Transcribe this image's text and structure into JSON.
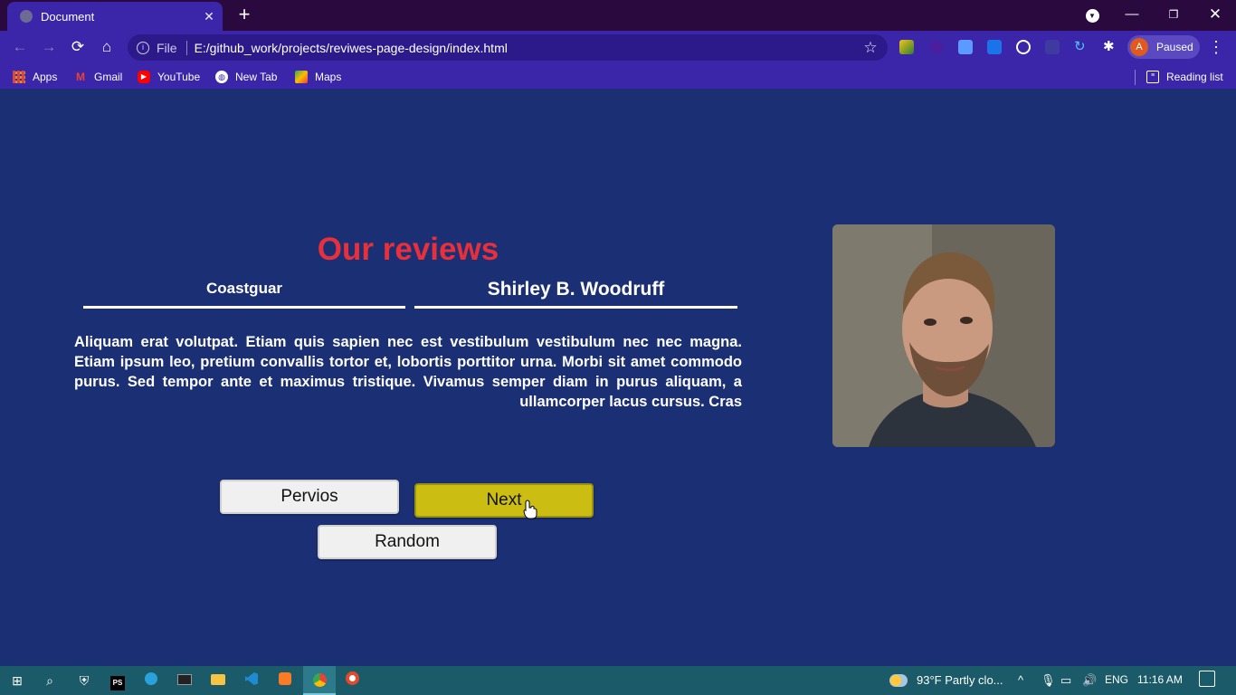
{
  "browser": {
    "tab_title": "Document",
    "tab_close": "✕",
    "new_tab": "+",
    "url_scheme_label": "File",
    "url": "E:/github_work/projects/reviwes-page-design/index.html",
    "profile_initial": "A",
    "profile_status": "Paused",
    "window_controls": {
      "minimize": "—",
      "maximize": "❐",
      "close": "✕"
    }
  },
  "bookmarks": [
    {
      "label": "Apps",
      "icon": "apps-grid-icon"
    },
    {
      "label": "Gmail",
      "icon": "gmail-icon",
      "glyph": "M"
    },
    {
      "label": "YouTube",
      "icon": "youtube-icon",
      "glyph": "▶"
    },
    {
      "label": "New Tab",
      "icon": "globe-icon",
      "glyph": "◍"
    },
    {
      "label": "Maps",
      "icon": "maps-icon"
    }
  ],
  "reading_list": {
    "label": "Reading list",
    "icon": "reading-list-icon"
  },
  "page": {
    "title": "Our reviews",
    "left_heading": "Coastguar",
    "right_heading": "Shirley B. Woodruff",
    "review_text": "Aliquam erat volutpat. Etiam quis sapien nec est vestibulum vestibulum nec nec magna. Etiam ipsum leo, pretium convallis tortor et, lobortis porttitor urna. Morbi sit amet commodo purus. Sed tempor ante et maximus tristique. Vivamus semper diam in purus aliquam, a ullamcorper lacus cursus. Cras",
    "buttons": {
      "previous": "Pervios",
      "next": "Next",
      "random": "Random"
    },
    "colors": {
      "background": "#1b2f75",
      "title": "#e8303b",
      "next_button": "#cbbd12"
    }
  },
  "taskbar": {
    "weather": "93°F  Partly clo...",
    "language": "ENG",
    "clock": "11:16 AM"
  }
}
